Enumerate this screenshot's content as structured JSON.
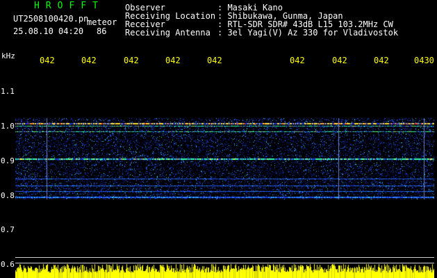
{
  "header": {
    "brand": "HROFFT",
    "filename": "UT2508100420.pn",
    "mode": "meteor",
    "datetime": "25.08.10 04:20",
    "count": "86",
    "info": [
      {
        "label": "Observer",
        "value": ": Masaki Kano"
      },
      {
        "label": "Receiving Location",
        "value": ": Shibukawa, Gunma, Japan"
      },
      {
        "label": "Receiver",
        "value": ": RTL-SDR SDR# 43dB L15 103.2MHz CW"
      },
      {
        "label": "Receiving Antenna",
        "value": ": 3el Yagi(V) Az 330 for Vladivostok"
      }
    ]
  },
  "axis": {
    "y_unit": "kHz",
    "x_ticks": [
      "042",
      "042",
      "042",
      "042",
      "042",
      "042",
      "042",
      "042",
      "0430"
    ],
    "y_ticks": [
      "1.1",
      "1.0",
      "0.9",
      "0.8",
      "0.7",
      "0.6"
    ]
  },
  "colors": {
    "background": "#000000",
    "header_text": "#ffffff",
    "brand_text": "#00ff00",
    "tick_text": "#ffff00",
    "spectrogram_base": "#0a1e8c",
    "signal_high": "#ff3030"
  }
}
